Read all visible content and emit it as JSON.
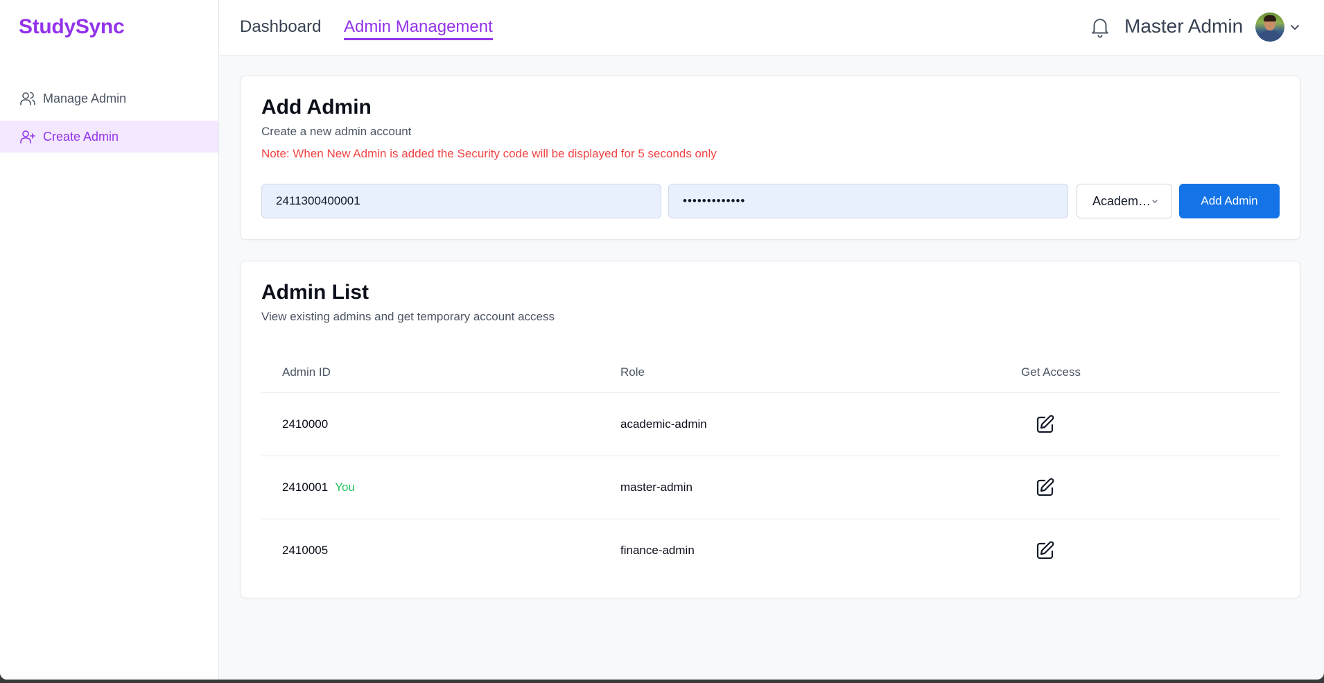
{
  "app": {
    "brand": "StudySync"
  },
  "sidebar": {
    "items": [
      {
        "label": "Manage Admin",
        "icon": "users-icon",
        "active": false
      },
      {
        "label": "Create Admin",
        "icon": "user-plus-icon",
        "active": true
      }
    ]
  },
  "topbar": {
    "tabs": [
      {
        "label": "Dashboard",
        "active": false
      },
      {
        "label": "Admin Management",
        "active": true
      }
    ],
    "user_name": "Master Admin",
    "icons": [
      "bell-icon",
      "avatar",
      "chevron-down-icon"
    ]
  },
  "add_admin": {
    "title": "Add Admin",
    "subtitle": "Create a new admin account",
    "note": "Note: When New Admin is added the Security code will be displayed for 5 seconds only",
    "admin_id_value": "2411300400001",
    "password_value": "•••••••••••••",
    "role_select_value": "Academ…",
    "submit_label": "Add Admin"
  },
  "admin_list": {
    "title": "Admin List",
    "subtitle": "View existing admins and get temporary account access",
    "columns": [
      "Admin ID",
      "Role",
      "Get Access"
    ],
    "rows": [
      {
        "id": "2410000",
        "tag": "",
        "role": "academic-admin",
        "action_icon": "edit-icon"
      },
      {
        "id": "2410001",
        "tag": "You",
        "role": "master-admin",
        "action_icon": "edit-icon"
      },
      {
        "id": "2410005",
        "tag": "",
        "role": "finance-admin",
        "action_icon": "edit-icon"
      }
    ]
  },
  "colors": {
    "brand": "#9333ea",
    "active_nav_bg": "#f3e8ff",
    "primary_button": "#1473e6",
    "note_text": "#ef4444",
    "you_tag": "#22c55e",
    "input_bg": "#e8f0fe"
  }
}
